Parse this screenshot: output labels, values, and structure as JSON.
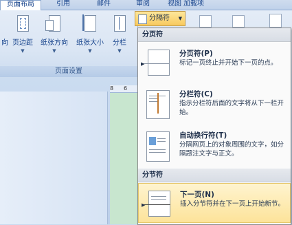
{
  "ribbon": {
    "tabs": [
      {
        "label": "页面布局",
        "active": true
      },
      {
        "label": "引用"
      },
      {
        "label": "邮件"
      },
      {
        "label": "审阅"
      },
      {
        "label": "视图"
      },
      {
        "label": "加载项"
      }
    ],
    "buttons": {
      "orientation_partial": "向",
      "margins": "页边距",
      "orientation": "纸张方向",
      "size": "纸张大小",
      "columns": "分栏",
      "breaks": "分隔符"
    },
    "group_label": "页面设置"
  },
  "ruler": {
    "marks": [
      "8",
      "6"
    ]
  },
  "menu": {
    "section_page": "分页符",
    "section_section": "分节符",
    "items": [
      {
        "title": "分页符(P)",
        "desc": "标记一页终止并开始下一页的点。"
      },
      {
        "title": "分栏符(C)",
        "desc": "指示分栏符后面的文字将从下一栏开始。"
      },
      {
        "title": "自动换行符(T)",
        "desc": "分隔网页上的对象周围的文字，如分隔题注文字与正文。"
      },
      {
        "title": "下一页(N)",
        "desc": "插入分节符并在下一页上开始新节。"
      }
    ]
  },
  "colors": {
    "highlight": "#fde39a",
    "ribbon_text": "#15428b"
  }
}
